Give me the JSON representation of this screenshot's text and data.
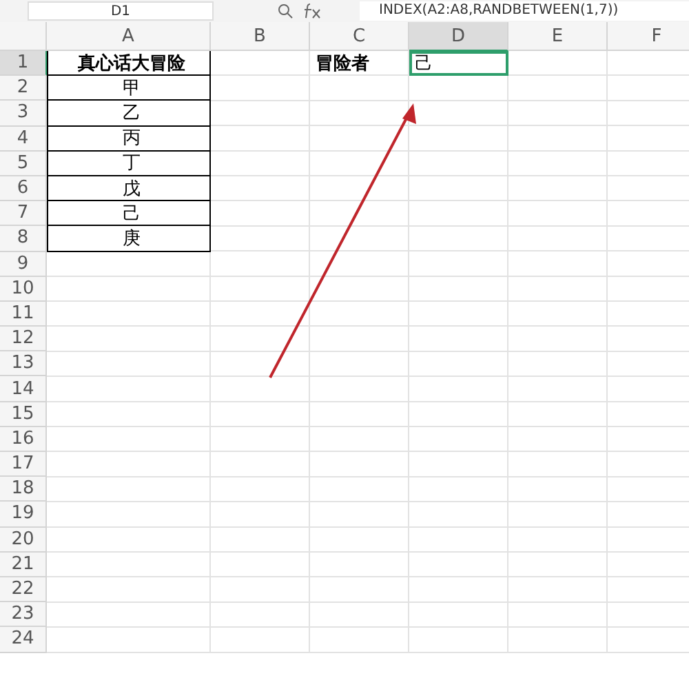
{
  "name_box": "D1",
  "formula": "INDEX(A2:A8,RANDBETWEEN(1,7))",
  "columns": [
    {
      "label": "A",
      "selected": false
    },
    {
      "label": "B",
      "selected": false
    },
    {
      "label": "C",
      "selected": false
    },
    {
      "label": "D",
      "selected": true
    },
    {
      "label": "E",
      "selected": false
    },
    {
      "label": "F",
      "selected": false
    }
  ],
  "rows": [
    {
      "number": "1",
      "selected": true,
      "A": {
        "text": "真心话大冒险",
        "bold": true,
        "boxed": true,
        "selected": false
      },
      "C": {
        "text": "冒险者",
        "bold": true,
        "boxed": false,
        "selected": false
      },
      "D": {
        "text": "己",
        "bold": false,
        "boxed": false,
        "selected": true
      }
    },
    {
      "number": "2",
      "selected": false,
      "A": {
        "text": "甲",
        "bold": false,
        "boxed": true,
        "selected": false
      }
    },
    {
      "number": "3",
      "selected": false,
      "A": {
        "text": "乙",
        "bold": false,
        "boxed": true,
        "selected": false
      }
    },
    {
      "number": "4",
      "selected": false,
      "A": {
        "text": "丙",
        "bold": false,
        "boxed": true,
        "selected": false
      }
    },
    {
      "number": "5",
      "selected": false,
      "A": {
        "text": "丁",
        "bold": false,
        "boxed": true,
        "selected": false
      }
    },
    {
      "number": "6",
      "selected": false,
      "A": {
        "text": "戊",
        "bold": false,
        "boxed": true,
        "selected": false
      }
    },
    {
      "number": "7",
      "selected": false,
      "A": {
        "text": "己",
        "bold": false,
        "boxed": true,
        "selected": false
      }
    },
    {
      "number": "8",
      "selected": false,
      "A": {
        "text": "庚",
        "bold": false,
        "boxed": true,
        "selected": false
      }
    },
    {
      "number": "9",
      "selected": false
    },
    {
      "number": "10",
      "selected": false
    },
    {
      "number": "11",
      "selected": false
    },
    {
      "number": "12",
      "selected": false
    },
    {
      "number": "13",
      "selected": false
    },
    {
      "number": "14",
      "selected": false
    },
    {
      "number": "15",
      "selected": false
    },
    {
      "number": "16",
      "selected": false
    },
    {
      "number": "17",
      "selected": false
    },
    {
      "number": "18",
      "selected": false
    },
    {
      "number": "19",
      "selected": false
    },
    {
      "number": "20",
      "selected": false
    },
    {
      "number": "21",
      "selected": false
    },
    {
      "number": "22",
      "selected": false
    },
    {
      "number": "23",
      "selected": false
    },
    {
      "number": "24",
      "selected": false
    }
  ]
}
